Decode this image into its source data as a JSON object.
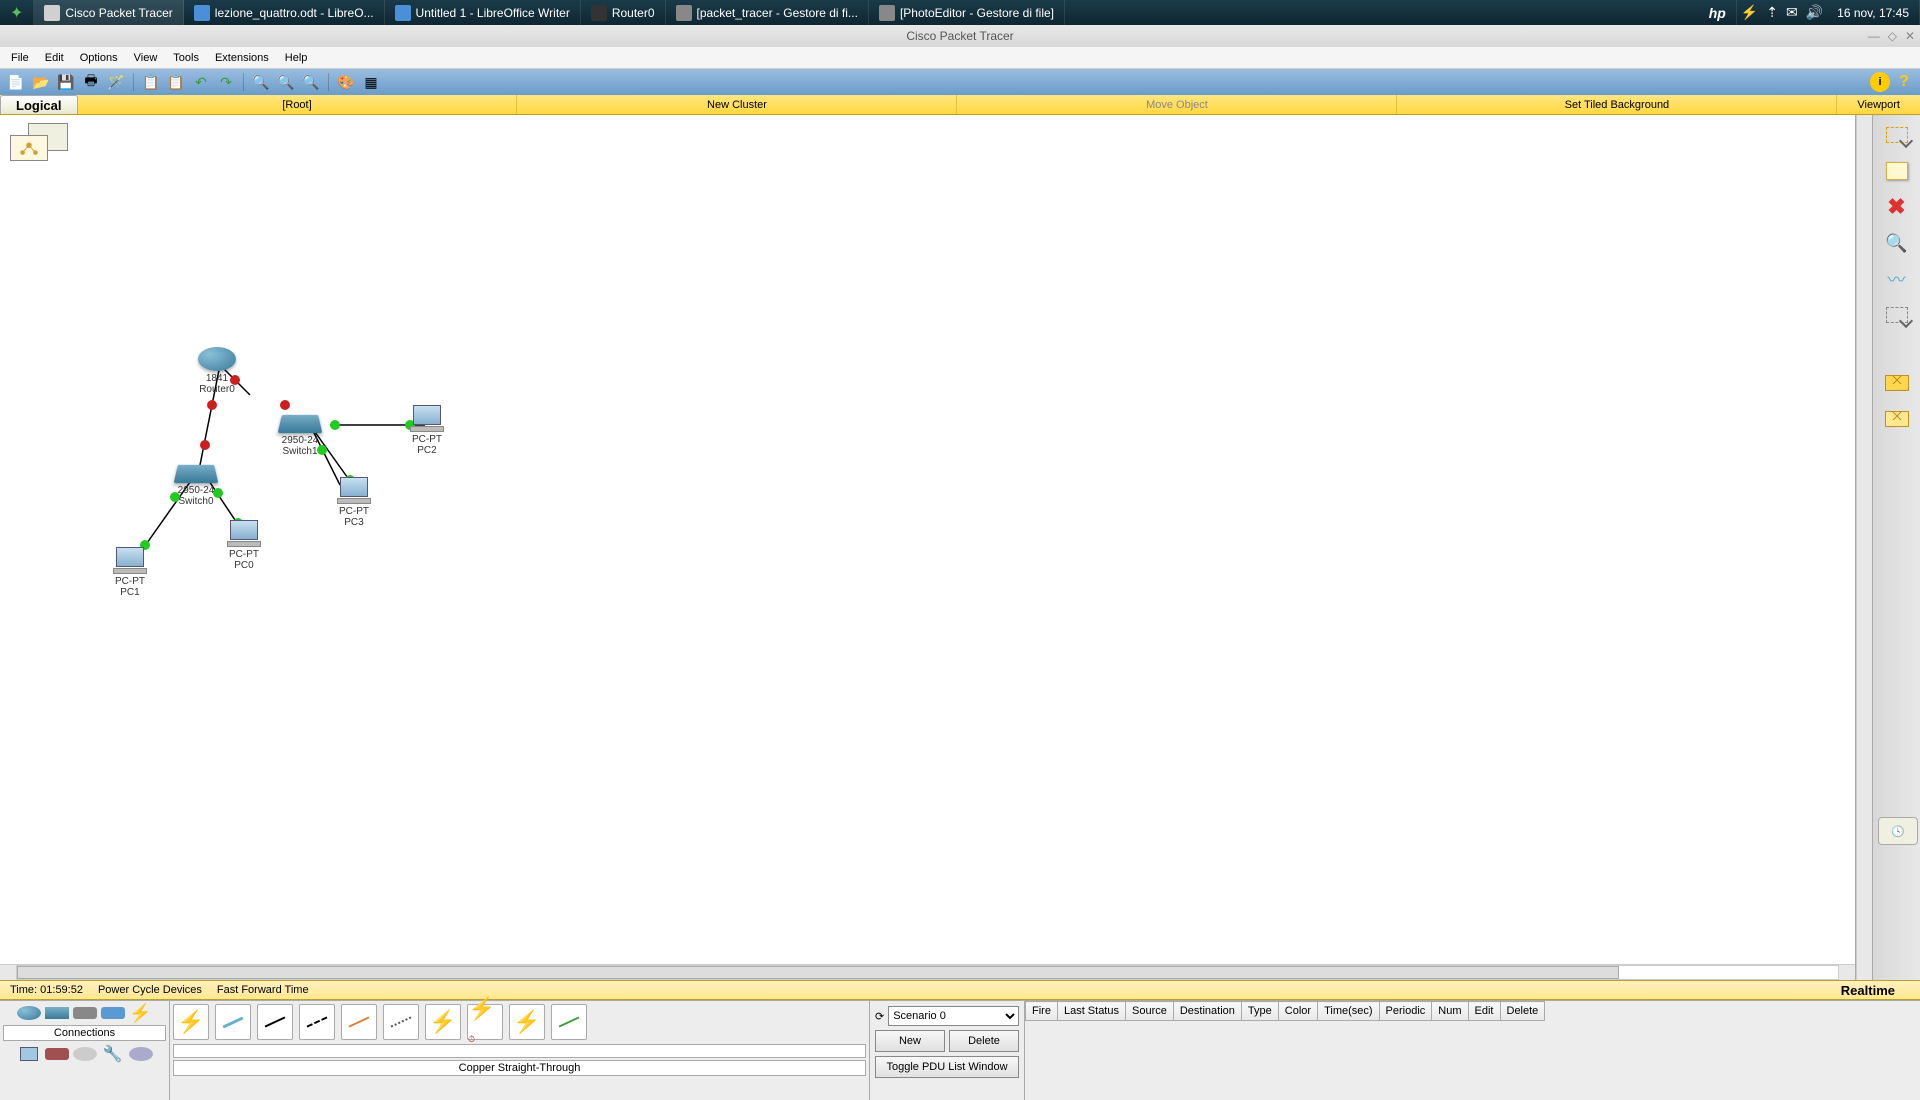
{
  "taskbar": {
    "items": [
      {
        "label": "Cisco Packet Tracer"
      },
      {
        "label": "lezione_quattro.odt - LibreO..."
      },
      {
        "label": "Untitled 1 - LibreOffice Writer"
      },
      {
        "label": "Router0"
      },
      {
        "label": "[packet_tracer - Gestore di fi..."
      },
      {
        "label": "[PhotoEditor - Gestore di file]"
      }
    ],
    "date": "16 nov, 17:45",
    "hp": "hp"
  },
  "window": {
    "title": "Cisco Packet Tracer"
  },
  "menu": [
    "File",
    "Edit",
    "Options",
    "View",
    "Tools",
    "Extensions",
    "Help"
  ],
  "yellowbar": {
    "logical": "Logical",
    "root": "[Root]",
    "new_cluster": "New Cluster",
    "move_object": "Move Object",
    "set_tiled": "Set Tiled Background",
    "viewport": "Viewport"
  },
  "timebar": {
    "time": "Time: 01:59:52",
    "power_cycle": "Power Cycle Devices",
    "fast_forward": "Fast Forward Time",
    "realtime": "Realtime"
  },
  "topology": {
    "router0": {
      "model": "1841",
      "name": "Router0"
    },
    "switch0": {
      "model": "2950-24",
      "name": "Switch0"
    },
    "switch1": {
      "model": "2950-24",
      "name": "Switch1"
    },
    "pc0": {
      "model": "PC-PT",
      "name": "PC0"
    },
    "pc1": {
      "model": "PC-PT",
      "name": "PC1"
    },
    "pc2": {
      "model": "PC-PT",
      "name": "PC2"
    },
    "pc3": {
      "model": "PC-PT",
      "name": "PC3"
    }
  },
  "device_panel": {
    "selected": "Connections"
  },
  "cable_panel": {
    "selected": "Copper Straight-Through"
  },
  "scenario": {
    "selected": "Scenario 0",
    "new": "New",
    "delete": "Delete",
    "toggle": "Toggle PDU List Window"
  },
  "pdu_headers": [
    "Fire",
    "Last Status",
    "Source",
    "Destination",
    "Type",
    "Color",
    "Time(sec)",
    "Periodic",
    "Num",
    "Edit",
    "Delete"
  ]
}
